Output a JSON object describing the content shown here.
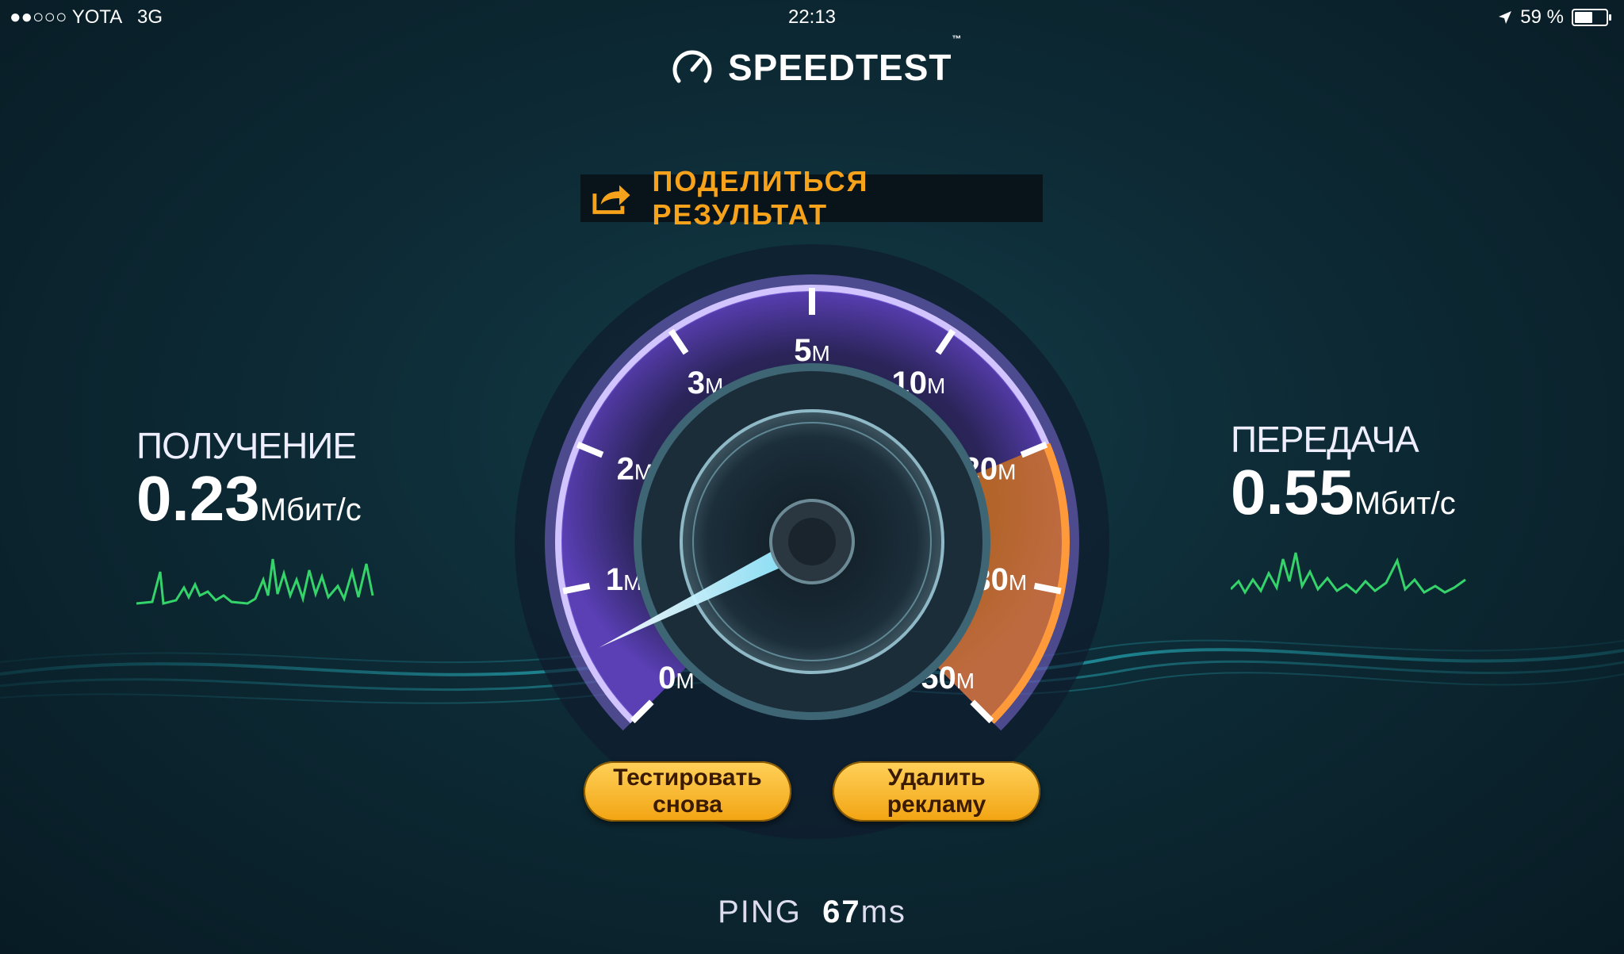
{
  "status_bar": {
    "carrier": "●●○○○ YOTA",
    "network": "3G",
    "time": "22:13",
    "battery": "59 %",
    "battery_level": 0.59,
    "icons": [
      "location-arrow-icon",
      "battery-icon"
    ]
  },
  "app": {
    "title": "SPEEDTEST",
    "trademark": "™",
    "logo_icon": "speedometer-icon"
  },
  "share": {
    "label": "ПОДЕЛИТЬСЯ  РЕЗУЛЬТАТ",
    "icon": "share-icon"
  },
  "download": {
    "label": "ПОЛУЧЕНИЕ",
    "value": "0.23",
    "unit": "Мбит/с"
  },
  "upload": {
    "label": "ПЕРЕДАЧА",
    "value": "0.55",
    "unit": "Мбит/с"
  },
  "gauge": {
    "ticks": [
      {
        "num": "0",
        "unit": "M"
      },
      {
        "num": "1",
        "unit": "M"
      },
      {
        "num": "2",
        "unit": "M"
      },
      {
        "num": "3",
        "unit": "M"
      },
      {
        "num": "5",
        "unit": "M"
      },
      {
        "num": "10",
        "unit": "M"
      },
      {
        "num": "20",
        "unit": "M"
      },
      {
        "num": "30",
        "unit": "M"
      },
      {
        "num": "50",
        "unit": "M"
      }
    ],
    "needle_value_mbps": 0.55,
    "colors": {
      "arc": "#7b5cd6",
      "highlight": "#f08a1e",
      "needle": "#bff6ff"
    }
  },
  "buttons": {
    "retest_line1": "Тестировать",
    "retest_line2": "снова",
    "remove_ads_line1": "Удалить",
    "remove_ads_line2": "рекламу"
  },
  "ping": {
    "label": "PING",
    "value": "67",
    "unit": "ms"
  },
  "colors": {
    "accent": "#f6a21a",
    "background": "#0d2a35",
    "graph": "#35d46a"
  }
}
